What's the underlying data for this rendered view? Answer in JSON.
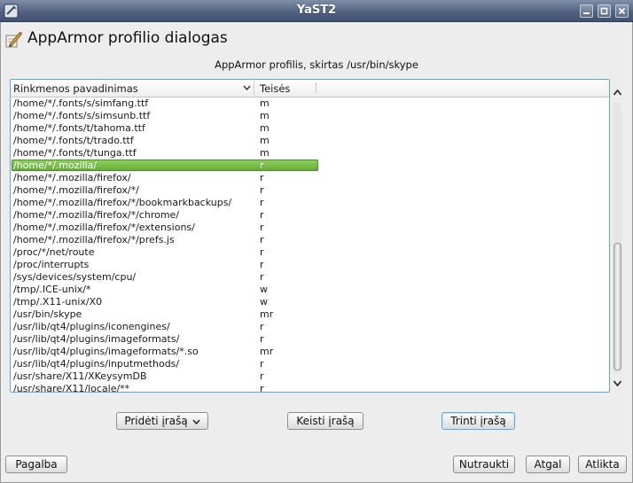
{
  "window": {
    "title": "YaST2",
    "icon": "yast-icon",
    "controls": [
      "minimize-icon",
      "maximize-icon",
      "close-icon"
    ]
  },
  "dialog": {
    "icon": "apparmor-pen-icon",
    "title": "AppArmor profilio dialogas",
    "subtitle": "AppArmor profilis, skirtas /usr/bin/skype"
  },
  "table": {
    "columns": [
      "Rinkmenos pavadinimas",
      "Teisės"
    ],
    "selected_index": 5,
    "rows": [
      {
        "name": "/home/*/.fonts/s/simfang.ttf",
        "perm": "m"
      },
      {
        "name": "/home/*/.fonts/s/simsunb.ttf",
        "perm": "m"
      },
      {
        "name": "/home/*/.fonts/t/tahoma.ttf",
        "perm": "m"
      },
      {
        "name": "/home/*/.fonts/t/trado.ttf",
        "perm": "m"
      },
      {
        "name": "/home/*/.fonts/t/tunga.ttf",
        "perm": "m"
      },
      {
        "name": "/home/*/.mozilla/",
        "perm": "r"
      },
      {
        "name": "/home/*/.mozilla/firefox/",
        "perm": "r"
      },
      {
        "name": "/home/*/.mozilla/firefox/*/",
        "perm": "r"
      },
      {
        "name": "/home/*/.mozilla/firefox/*/bookmarkbackups/",
        "perm": "r"
      },
      {
        "name": "/home/*/.mozilla/firefox/*/chrome/",
        "perm": "r"
      },
      {
        "name": "/home/*/.mozilla/firefox/*/extensions/",
        "perm": "r"
      },
      {
        "name": "/home/*/.mozilla/firefox/*/prefs.js",
        "perm": "r"
      },
      {
        "name": "/proc/*/net/route",
        "perm": "r"
      },
      {
        "name": "/proc/interrupts",
        "perm": "r"
      },
      {
        "name": "/sys/devices/system/cpu/",
        "perm": "r"
      },
      {
        "name": "/tmp/.ICE-unix/*",
        "perm": "w"
      },
      {
        "name": "/tmp/.X11-unix/X0",
        "perm": "w"
      },
      {
        "name": "/usr/bin/skype",
        "perm": "mr"
      },
      {
        "name": "/usr/lib/qt4/plugins/iconengines/",
        "perm": "r"
      },
      {
        "name": "/usr/lib/qt4/plugins/imageformats/",
        "perm": "r"
      },
      {
        "name": "/usr/lib/qt4/plugins/imageformats/*.so",
        "perm": "mr"
      },
      {
        "name": "/usr/lib/qt4/plugins/inputmethods/",
        "perm": "r"
      },
      {
        "name": "/usr/share/X11/XKeysymDB",
        "perm": "r"
      },
      {
        "name": "/usr/share/X11/locale/**",
        "perm": "r"
      }
    ]
  },
  "actions": {
    "add": "Pridėti įrašą",
    "edit": "Keisti įrašą",
    "delete": "Trinti įrašą"
  },
  "footer": {
    "help": "Pagalba",
    "cancel": "Nutraukti",
    "back": "Atgal",
    "next": "Atlikta"
  },
  "colors": {
    "selection": "#6cb33f",
    "focus": "#5aa9d8",
    "titlebar": "#52627f"
  }
}
